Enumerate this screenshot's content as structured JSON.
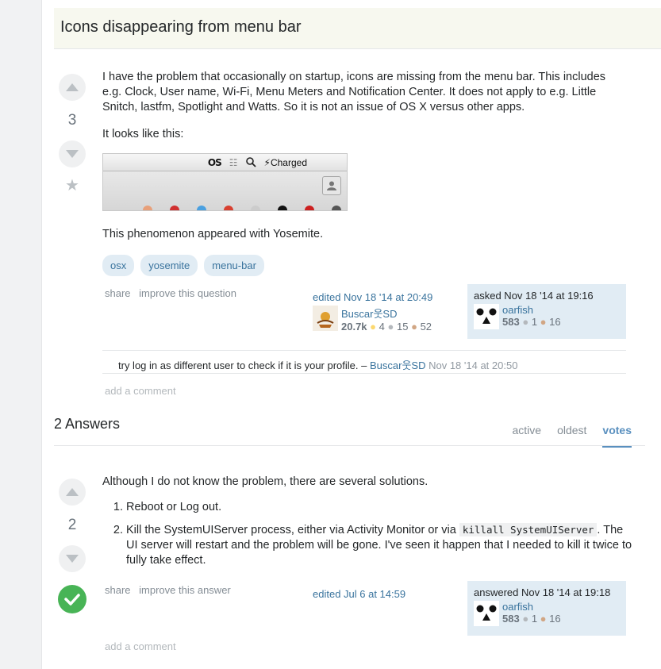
{
  "question": {
    "title": "Icons disappearing from menu bar",
    "vote_count": "3",
    "paragraphs": [
      "I have the problem that occasionally on startup, icons are missing from the menu bar. This includes e.g. Clock, User name, Wi-Fi, Menu Meters and Notification Center. It does not apply to e.g. Little Snitch, lastfm, Spotlight and Watts. So it is not an issue of OS X versus other apps.",
      "It looks like this:",
      "This phenomenon appeared with Yosemite."
    ],
    "screenshot": {
      "menubar_text": "Charged",
      "lastfm_glyph": "ɑѕ",
      "search_glyph": "⚲"
    },
    "tags": [
      "osx",
      "yosemite",
      "menu-bar"
    ],
    "menu": {
      "share": "share",
      "improve": "improve this question"
    },
    "editor": {
      "action": "edited Nov 18 '14 at 20:49",
      "name": "Buscar웃SD",
      "rep": "20.7k",
      "gold": "4",
      "silver": "15",
      "bronze": "52"
    },
    "owner": {
      "action": "asked Nov 18 '14 at 19:16",
      "name": "oarfish",
      "rep": "583",
      "silver": "1",
      "bronze": "16"
    },
    "comment": {
      "text": "try log in as different user to check if it is your profile. –",
      "user": "Buscar웃SD",
      "date": "Nov 18 '14 at 20:50"
    },
    "add_comment": "add a comment"
  },
  "answers_header": {
    "count_label": "2 Answers",
    "tabs": [
      "active",
      "oldest",
      "votes"
    ],
    "active_tab": "votes"
  },
  "answer": {
    "vote_count": "2",
    "intro": "Although I do not know the problem, there are several solutions.",
    "steps": [
      {
        "num": "1.",
        "text": "Reboot or Log out."
      },
      {
        "num": "2.",
        "text_before": "Kill the SystemUIServer process, either via Activity Monitor or via ",
        "code": "killall SystemUIServer",
        "text_after": ". The UI server will restart and the problem will be gone. I've seen it happen that I needed to kill it twice to fully take effect."
      }
    ],
    "menu": {
      "share": "share",
      "improve": "improve this answer"
    },
    "edited": "edited Jul 6 at 14:59",
    "owner": {
      "action": "answered Nov 18 '14 at 19:18",
      "name": "oarfish",
      "rep": "583",
      "silver": "1",
      "bronze": "16"
    },
    "add_comment": "add a comment"
  },
  "colors": {
    "link": "#39739d",
    "tag_bg": "#e1ecf4",
    "accepted": "#48b456",
    "title_bg": "#f7f8ef"
  }
}
